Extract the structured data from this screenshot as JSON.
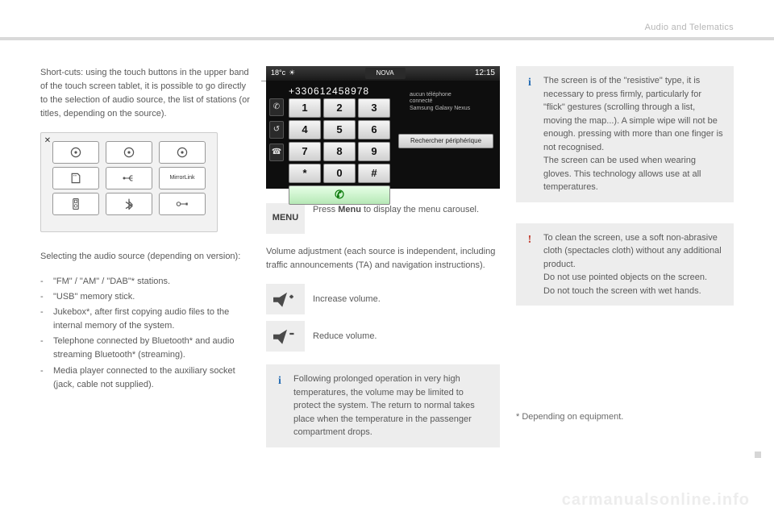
{
  "header": {
    "section": "Audio and Telematics"
  },
  "col1": {
    "shortcuts": "Short-cuts: using the touch buttons in the upper band of the touch screen tablet, it is possible to go directly to the selection of audio source, the list of stations (or titles, depending on the source).",
    "panel": {
      "close": "✕",
      "btn_radio1": "◎",
      "btn_radio2": "◎",
      "btn_radio3": "◎",
      "btn_sd": "sd",
      "btn_usb": "usb",
      "btn_mirror": "MirrorLink",
      "btn_ipod": "ipod",
      "btn_bt": "✱",
      "btn_aux": "aux"
    },
    "selecting_intro": "Selecting the audio source (depending on version):",
    "items": [
      "\"FM\" / \"AM\" / \"DAB\"* stations.",
      "\"USB\" memory stick.",
      "Jukebox*, after first copying audio files to the internal memory of the system.",
      "Telephone connected by Bluetooth* and audio streaming Bluetooth* (streaming).",
      "Media player connected to the auxiliary socket (jack, cable not supplied)."
    ]
  },
  "col2": {
    "phone": {
      "temp": "18°c",
      "nova": "NOVA",
      "clock": "12:15",
      "number": "+330612458978",
      "rtxt": "aucun téléphone\nconnecté\nSamsung Galaxy Nexus",
      "rbtn": "Rechercher périphérique",
      "keys": [
        "1",
        "2",
        "3",
        "4",
        "5",
        "6",
        "7",
        "8",
        "9",
        "*",
        "0",
        "#"
      ]
    },
    "menu": {
      "label": "MENU",
      "text_a": "Press ",
      "text_bold": "Menu",
      "text_b": " to display the menu carousel."
    },
    "volume_intro": "Volume adjustment (each source is independent, including traffic announcements (TA) and navigation instructions).",
    "increase": "Increase volume.",
    "reduce": "Reduce volume.",
    "heatnote": "Following prolonged operation in very high temperatures, the volume may be limited to protect the system. The return to normal takes place when the temperature in the passenger compartment drops."
  },
  "col3": {
    "resistive": "The screen is of the \"resistive\" type, it is necessary to press firmly, particularly for \"flick\" gestures (scrolling through a list, moving the map...). A simple wipe will not be enough. pressing with more than one finger is not recognised.\nThe screen can be used when wearing gloves. This technology allows use at all temperatures.",
    "clean": "To clean the screen, use a soft non-abrasive cloth (spectacles cloth) without any additional product.\nDo not use pointed objects on the screen.\nDo not touch the screen with wet hands.",
    "footnote": "* Depending on equipment."
  },
  "watermark": "carmanualsonline.info"
}
